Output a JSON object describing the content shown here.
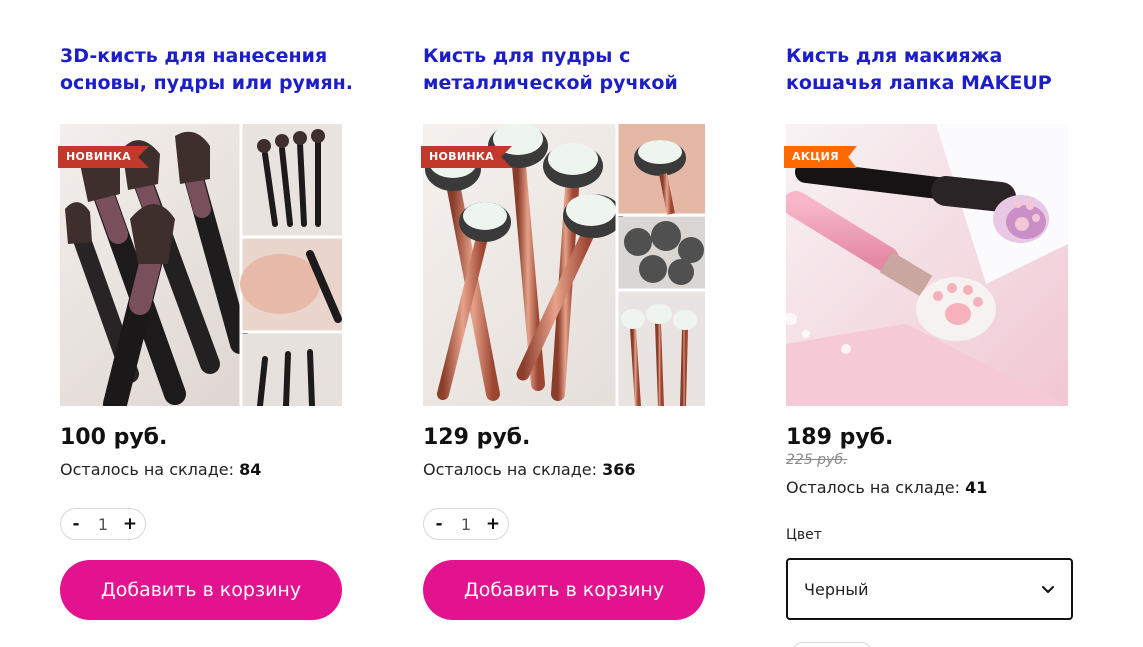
{
  "products": [
    {
      "title": "3D-кисть для нанесения основы, пудры или румян.",
      "badge": "НОВИНКА",
      "price": "100 руб.",
      "stock_label": "Осталось на складе:",
      "stock_value": "84",
      "qty_minus": "-",
      "qty_value": "1",
      "qty_plus": "+",
      "cart_label": "Добавить в корзину"
    },
    {
      "title": "Кисть для пудры с металлической ручкой",
      "badge": "НОВИНКА",
      "price": "129 руб.",
      "stock_label": "Осталось на складе:",
      "stock_value": "366",
      "qty_minus": "-",
      "qty_value": "1",
      "qty_plus": "+",
      "cart_label": "Добавить в корзину"
    },
    {
      "title": "Кисть для макияжа кошачья лапка MAKEUP",
      "badge": "АКЦИЯ",
      "price": "189 руб.",
      "old_price": "225 руб.",
      "stock_label": "Осталось на складе:",
      "stock_value": "41",
      "color_label": "Цвет",
      "color_selected": "Черный"
    }
  ],
  "colors": {
    "title": "#1c1ec7",
    "accent_button": "#e3128f",
    "badge_new": "#c0392b",
    "badge_sale": "#ff6a00"
  }
}
